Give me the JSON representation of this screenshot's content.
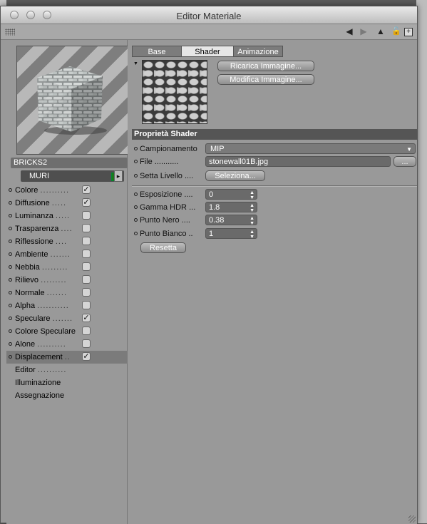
{
  "window": {
    "title": "Editor Materiale"
  },
  "preview": {
    "material_name": "BRICKS2"
  },
  "layer": {
    "name": "MURI",
    "color": "#1a7a1a"
  },
  "channels": [
    {
      "label": "Colore",
      "dots": "..........",
      "checked": true
    },
    {
      "label": "Diffusione",
      "dots": ".....",
      "checked": true
    },
    {
      "label": "Luminanza",
      "dots": ".....",
      "checked": false
    },
    {
      "label": "Trasparenza",
      "dots": "....",
      "checked": false
    },
    {
      "label": "Riflessione",
      "dots": "....",
      "checked": false
    },
    {
      "label": "Ambiente",
      "dots": ".......",
      "checked": false
    },
    {
      "label": "Nebbia",
      "dots": ".........",
      "checked": false
    },
    {
      "label": "Rilievo",
      "dots": ".........",
      "checked": false
    },
    {
      "label": "Normale",
      "dots": ".......",
      "checked": false
    },
    {
      "label": "Alpha",
      "dots": "...........",
      "checked": false
    },
    {
      "label": "Speculare",
      "dots": ".......",
      "checked": true
    },
    {
      "label": "Colore Speculare",
      "dots": "",
      "checked": false
    },
    {
      "label": "Alone",
      "dots": "..........",
      "checked": false
    },
    {
      "label": "Displacement",
      "dots": "..",
      "checked": true
    }
  ],
  "extra_items": [
    {
      "label": "Editor",
      "dots": ".........."
    },
    {
      "label": "Illuminazione",
      "dots": ""
    },
    {
      "label": "Assegnazione",
      "dots": ""
    }
  ],
  "tabs": [
    {
      "label": "Base",
      "active": false
    },
    {
      "label": "Shader",
      "active": true
    },
    {
      "label": "Animazione",
      "active": false
    }
  ],
  "buttons": {
    "reload_image": "Ricarica Immagine...",
    "edit_image": "Modifica Immagine...",
    "select": "Seleziona...",
    "browse": "...",
    "reset": "Resetta"
  },
  "section_title": "Proprietà Shader",
  "properties": {
    "sampling_label": "Campionamento",
    "sampling_value": "MIP",
    "file_label": "File",
    "file_dots": "...........",
    "file_value": "stonewall01B.jpg",
    "set_level_label": "Setta Livello",
    "set_level_dots": "....",
    "exposure_label": "Esposizione",
    "exposure_dots": "....",
    "exposure_value": "0",
    "hdr_gamma_label": "Gamma HDR",
    "hdr_gamma_dots": "...",
    "hdr_gamma_value": "1.8",
    "black_point_label": "Punto Nero",
    "black_point_dots": "....",
    "black_point_value": "0.38",
    "white_point_label": "Punto Bianco",
    "white_point_dots": "..",
    "white_point_value": "1"
  }
}
